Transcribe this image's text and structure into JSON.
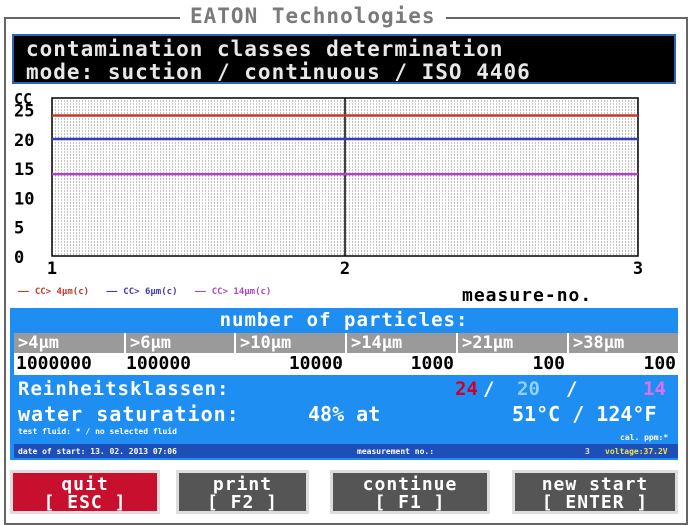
{
  "brand": "EATON Technologies",
  "header": {
    "line1": "contamination classes determination",
    "line2": "mode: suction / continuous / ISO 4406"
  },
  "chart_data": {
    "type": "line",
    "ylabel": "CC",
    "xlabel": "measure-no.",
    "x_ticks": [
      "1",
      "2",
      "3"
    ],
    "y_ticks": [
      "0",
      "5",
      "10",
      "15",
      "20",
      "25"
    ],
    "xlim": [
      1,
      3
    ],
    "ylim": [
      0,
      27
    ],
    "series": [
      {
        "name": "CC> 4µm(c)",
        "color": "#c0392b",
        "x": [
          1,
          3
        ],
        "y": [
          24,
          24
        ]
      },
      {
        "name": "CC> 6µm(c)",
        "color": "#3a3ab8",
        "x": [
          1,
          3
        ],
        "y": [
          20,
          20
        ]
      },
      {
        "name": "CC> 14µm(c)",
        "color": "#b044c8",
        "x": [
          1,
          3
        ],
        "y": [
          14,
          14
        ]
      }
    ],
    "grid": true
  },
  "particles": {
    "title": "number of particles:",
    "sizes": [
      ">4µm",
      ">6µm",
      ">10µm",
      ">14µm",
      ">21µm",
      ">38µm"
    ],
    "counts": [
      "1000000",
      "100000",
      "10000",
      "1000",
      "100",
      "100"
    ]
  },
  "reinheit": {
    "label": "Reinheitsklassen:",
    "v1": "24",
    "sep1": "/",
    "v2": "20",
    "sep2": "/",
    "v3": "14",
    "v1_color": "#d0002a",
    "v2_color": "#1e8ef2",
    "v3_color": "#c040d0"
  },
  "water": {
    "label": "water saturation:",
    "value": "48% at",
    "temp": "51°C / 124°F",
    "test_fluid": "test fluid: * / no selected fluid",
    "cal": "cal. ppm:*"
  },
  "date_line": {
    "start": "date of start: 13. 02. 2013  07:06",
    "measurement_label": "measurement no.:",
    "measurement_no": "3",
    "voltage": "voltage:37.2V"
  },
  "buttons": [
    {
      "title": "quit",
      "key": "[ ESC ]",
      "color": "#c8102e"
    },
    {
      "title": "print",
      "key": "[ F2 ]",
      "color": "#555555"
    },
    {
      "title": "continue",
      "key": "[ F1 ]",
      "color": "#555555"
    },
    {
      "title": "new start",
      "key": "[ ENTER ]",
      "color": "#555555"
    }
  ]
}
